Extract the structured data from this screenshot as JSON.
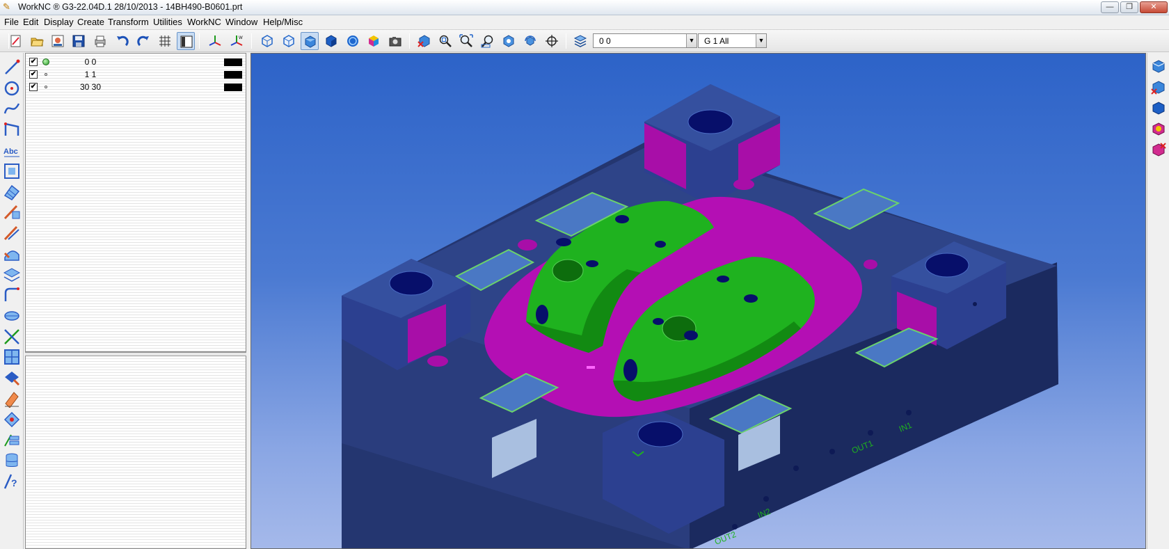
{
  "window": {
    "title": "WorkNC ® G3-22.04D.1   28/10/2013 - 14BH490-B0601.prt",
    "minimize_glyph": "—",
    "maximize_glyph": "❐",
    "close_glyph": "✕"
  },
  "menu": [
    {
      "label": "File"
    },
    {
      "label": "Edit"
    },
    {
      "label": "Display"
    },
    {
      "label": "Create"
    },
    {
      "label": "Transform"
    },
    {
      "label": "Utilities"
    },
    {
      "label": "WorkNC"
    },
    {
      "label": "Window"
    },
    {
      "label": "Help/Misc"
    }
  ],
  "toolbar": {
    "layer_combo": {
      "value": "0  0"
    },
    "group_combo": {
      "value": "G   1 All"
    },
    "buttons": [
      {
        "icon": "new-icon"
      },
      {
        "icon": "open-folder-icon"
      },
      {
        "icon": "workzone-icon"
      },
      {
        "icon": "save-icon"
      },
      {
        "icon": "print-icon"
      },
      {
        "icon": "undo-icon"
      },
      {
        "icon": "redo-icon"
      },
      {
        "icon": "grid-icon"
      },
      {
        "icon": "panel-toggle-icon"
      },
      {
        "icon": "axis-xy-icon"
      },
      {
        "icon": "axis-w-icon"
      },
      {
        "icon": "wireframe-view-icon"
      },
      {
        "icon": "hidden-line-icon"
      },
      {
        "icon": "shaded-view-icon"
      },
      {
        "icon": "solid-view-icon"
      },
      {
        "icon": "sphere-icon"
      },
      {
        "icon": "color-cube-icon"
      },
      {
        "icon": "camera-icon"
      },
      {
        "icon": "zoom-reset-icon"
      },
      {
        "icon": "zoom-window-icon"
      },
      {
        "icon": "zoom-fit-icon"
      },
      {
        "icon": "zoom-out-icon"
      },
      {
        "icon": "rotate-icon"
      },
      {
        "icon": "rotate-view-icon"
      },
      {
        "icon": "pan-icon"
      },
      {
        "icon": "layers-icon"
      }
    ]
  },
  "layers": [
    {
      "name": "0 0",
      "visible_glyph": "✔",
      "marker": "green",
      "color": "#000000"
    },
    {
      "name": "1 1",
      "visible_glyph": "✔",
      "marker": "small",
      "color": "#000000"
    },
    {
      "name": "30 30",
      "visible_glyph": "✔",
      "marker": "small",
      "color": "#000000"
    }
  ],
  "left_tools": [
    "line-icon",
    "circle-icon",
    "spline-icon",
    "curve-icon",
    "text-icon",
    "frame-icon",
    "surface-icon",
    "mesh-icon",
    "offset-icon",
    "fillet-icon",
    "plane-icon",
    "contour-icon",
    "section-icon",
    "intersect-icon",
    "grid-surface-icon",
    "paint-icon",
    "eraser-icon",
    "shape-icon",
    "stack-icon",
    "database-icon",
    "help-icon"
  ],
  "right_tools": [
    "view-iso-icon",
    "view-delete-icon",
    "view-solid-icon",
    "view-color-icon",
    "view-remove-icon"
  ],
  "model_labels": [
    {
      "text": "IN1"
    },
    {
      "text": "OUT1"
    },
    {
      "text": "IN2"
    },
    {
      "text": "OUT2"
    }
  ],
  "colors": {
    "viewport_top": "#2d63c8",
    "viewport_bottom": "#a5b9ea",
    "block": "#2c3f86",
    "pocket": "#b40fb4",
    "core": "#1fb21f",
    "hole": "#070f6a"
  }
}
